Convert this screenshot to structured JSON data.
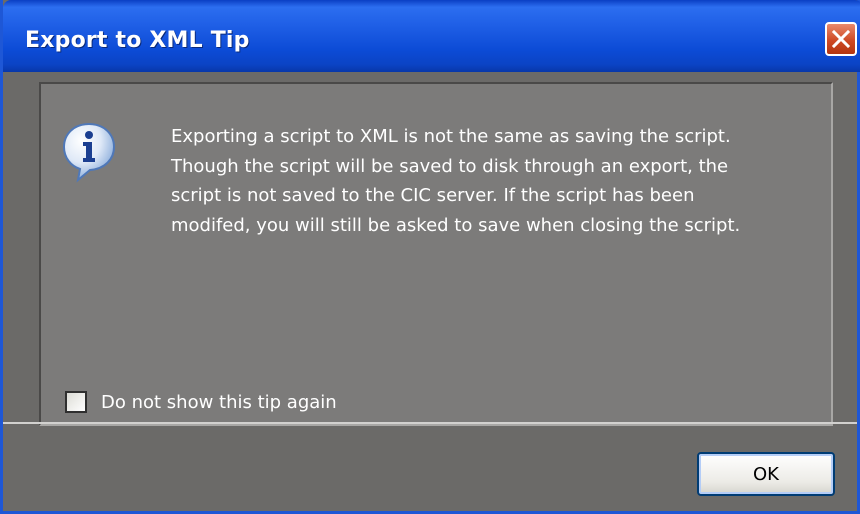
{
  "window": {
    "title": "Export to XML Tip",
    "close_icon": "close-icon"
  },
  "dialog": {
    "icon": "info-icon",
    "message_lines": [
      "Exporting a script to XML is not the same as saving the script.",
      "Though the script will be saved to disk through an export, the",
      "script is not saved to the CIC server. If the script has been",
      "modifed, you will still be asked to save when closing the script."
    ],
    "checkbox": {
      "label": "Do not show this tip again",
      "checked": false
    },
    "ok_label": "OK"
  },
  "colors": {
    "titlebar": "#1f5fe6",
    "body": "#6b6a68",
    "panel": "#7c7b7a",
    "close_button": "#cf4a25"
  }
}
